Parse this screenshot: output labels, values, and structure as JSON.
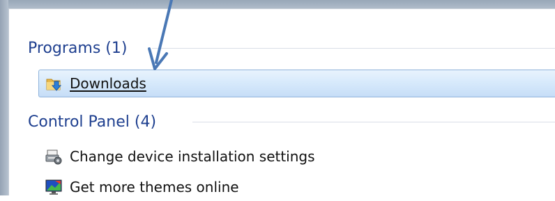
{
  "groups": {
    "programs": {
      "title": "Programs (1)",
      "items": [
        {
          "label": "Downloads",
          "icon": "downloads-folder-icon",
          "selected": true
        }
      ]
    },
    "control_panel": {
      "title": "Control Panel (4)",
      "items": [
        {
          "label": "Change device installation settings",
          "icon": "device-installation-icon"
        },
        {
          "label": "Get more themes online",
          "icon": "themes-monitor-icon"
        }
      ]
    }
  },
  "colors": {
    "header_text": "#1e3f8f",
    "selection_border": "#8fb3db",
    "annotation_arrow": "#4a78b5"
  }
}
